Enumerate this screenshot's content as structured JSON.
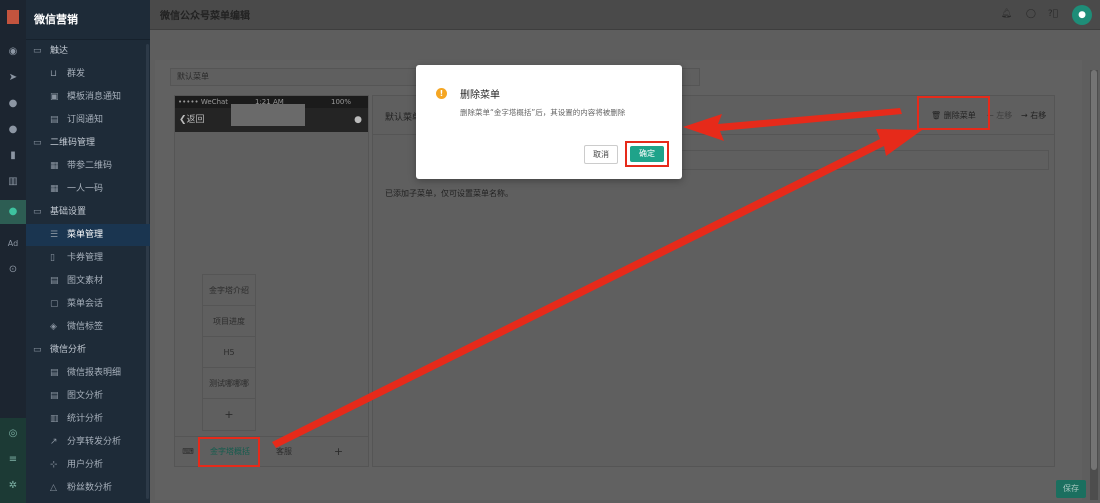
{
  "app": {
    "brand": "微信营销",
    "page_title": "微信公众号菜单编辑"
  },
  "sidebar": {
    "groups": [
      {
        "label": "触达",
        "items": [
          "群发",
          "模板消息通知",
          "订阅通知"
        ]
      },
      {
        "label": "二维码管理",
        "items": [
          "带参二维码",
          "一人一码"
        ]
      },
      {
        "label": "基础设置",
        "items": [
          "菜单管理",
          "卡券管理",
          "图文素材",
          "菜单会话",
          "微信标签"
        ]
      },
      {
        "label": "微信分析",
        "items": [
          "微信报表明细",
          "图文分析",
          "统计分析",
          "分享转发分析",
          "用户分析",
          "粉丝数分析"
        ]
      }
    ],
    "active_item": "菜单管理"
  },
  "menu_name_value": "默认菜单",
  "phone": {
    "carrier": "••••• WeChat",
    "time": "1:21 AM",
    "battery": "100%",
    "back_label": "返回",
    "sub_items": [
      "金字塔介绍",
      "项目进度",
      "H5",
      "测试哪哪哪",
      "+"
    ],
    "tabs": [
      "金字塔概括",
      "客服",
      "+"
    ]
  },
  "editor": {
    "title": "默认菜单",
    "hint": "已添加子菜单，仅可设置菜单名称。",
    "delete_label": "删除菜单",
    "left_label": "左移",
    "right_label": "右移"
  },
  "save_label": "保存",
  "modal": {
    "title": "删除菜单",
    "body": "删除菜单“金字塔概括”后，其设置的内容将被删除",
    "cancel": "取消",
    "confirm": "确定"
  },
  "colors": {
    "accent": "#1fa38a",
    "annotation": "#e62a1a",
    "warning": "#f5a623"
  }
}
